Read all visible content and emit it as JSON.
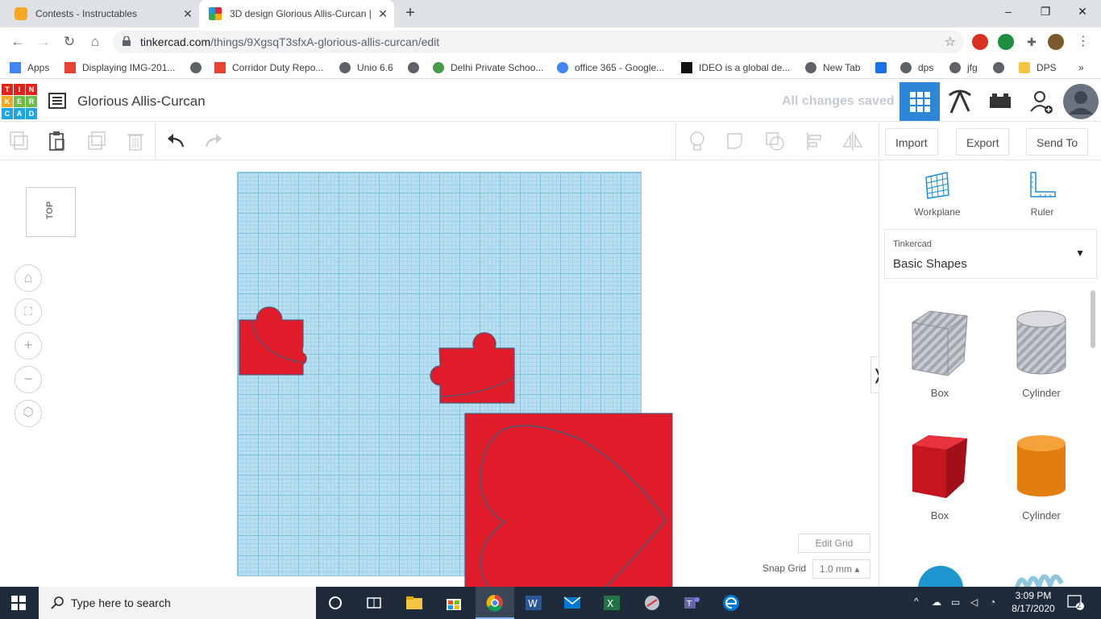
{
  "browser": {
    "tabs": [
      {
        "title": "Contests - Instructables",
        "active": false
      },
      {
        "title": "3D design Glorious Allis-Curcan |",
        "active": true
      }
    ],
    "url_host": "tinkercad.com",
    "url_path": "/things/9XgsqT3sfxA-glorious-allis-curcan/edit",
    "bookmarks": [
      "Apps",
      "Displaying IMG-201...",
      "Corridor Duty Repo...",
      "Unio 6.6",
      "Delhi Private Schoo...",
      "office 365 - Google...",
      "IDEO is a global de...",
      "New Tab",
      "dps",
      "jfg",
      "DPS"
    ],
    "more": "»"
  },
  "app": {
    "logo_letters": [
      "T",
      "I",
      "N",
      "K",
      "E",
      "R",
      "C",
      "A",
      "D"
    ],
    "design_title": "Glorious Allis-Curcan",
    "save_status": "All changes saved"
  },
  "toolbar": {
    "import_label": "Import",
    "export_label": "Export",
    "send_label": "Send To"
  },
  "viewport": {
    "viewcube_label": "TOP",
    "edit_grid_label": "Edit Grid",
    "snap_grid_label": "Snap Grid",
    "snap_grid_value": "1.0 mm ▴"
  },
  "panel": {
    "workplane_label": "Workplane",
    "ruler_label": "Ruler",
    "library_provider": "Tinkercad",
    "library_name": "Basic Shapes",
    "shapes": [
      {
        "label": "Box",
        "style": "hole",
        "color": "#b8bcc4"
      },
      {
        "label": "Cylinder",
        "style": "hole",
        "color": "#b8bcc4"
      },
      {
        "label": "Box",
        "style": "solid",
        "color": "#d31b25"
      },
      {
        "label": "Cylinder",
        "style": "solid",
        "color": "#e88114"
      }
    ]
  },
  "taskbar": {
    "search_placeholder": "Type here to search",
    "time": "3:09 PM",
    "date": "8/17/2020",
    "notifications": "2"
  },
  "colors": {
    "shape_red": "#e01b2a",
    "grid_blue": "#b7dff0",
    "accent": "#2e87d6"
  }
}
